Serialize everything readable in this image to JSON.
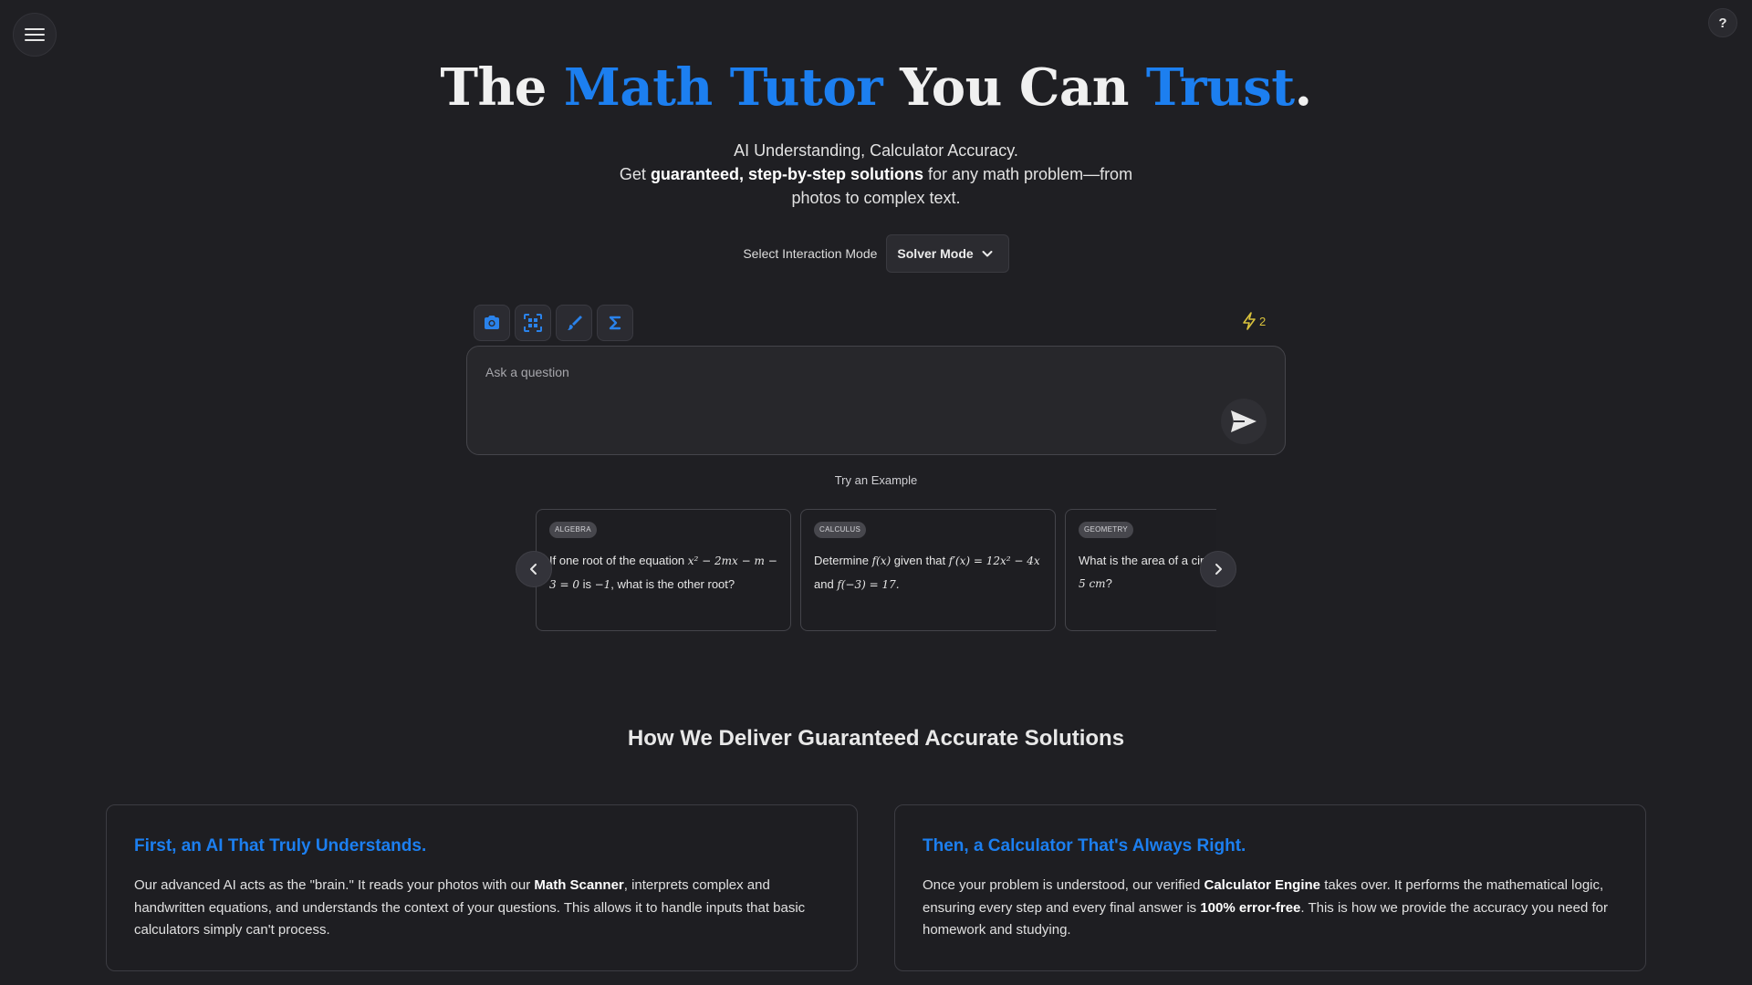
{
  "header": {
    "menu_icon": "hamburger-menu-icon",
    "help_label": "?"
  },
  "hero": {
    "title_parts": [
      "The ",
      "Math Tutor",
      " You Can ",
      "Trust",
      "."
    ],
    "accent_color": "#1c7ff0",
    "subtitle": "AI Understanding, Calculator Accuracy.",
    "desc_prefix": "Get ",
    "desc_bold": "guaranteed, step-by-step solutions",
    "desc_suffix": " for any math problem—from photos to complex text."
  },
  "mode": {
    "label": "Select Interaction Mode",
    "selected": "Solver Mode"
  },
  "tools": [
    {
      "icon": "camera-icon"
    },
    {
      "icon": "scan-icon"
    },
    {
      "icon": "brush-icon"
    },
    {
      "icon": "sigma-icon"
    }
  ],
  "credits": {
    "icon": "lightning-icon",
    "count": "2",
    "color": "#d9c23c"
  },
  "question": {
    "placeholder": "Ask a question"
  },
  "examples": {
    "label": "Try an Example",
    "cards": [
      {
        "tag": "ALGEBRA",
        "t1": "If one root of the equation ",
        "m1": "x² − 2mx − m − 3 = 0",
        "t2": " is ",
        "m2": "−1",
        "t3": ", what is the other root?"
      },
      {
        "tag": "CALCULUS",
        "t1": "Determine ",
        "m1": "f(x)",
        "t2": " given that ",
        "m2": "f′(x) = 12x² − 4x",
        "t3": " and ",
        "m3": "f(−3) = 17."
      },
      {
        "tag": "GEOMETRY",
        "t1": "What is the area of a circle with a radius of ",
        "m1": "5 cm",
        "t2": "?"
      }
    ]
  },
  "how": {
    "title": "How We Deliver Guaranteed Accurate Solutions",
    "features": [
      {
        "title": "First, an AI That Truly Understands.",
        "p1": "Our advanced AI acts as the \"brain.\" It reads your photos with our ",
        "b1": "Math Scanner",
        "p2": ", interprets complex and handwritten equations, and understands the context of your questions. This allows it to handle inputs that basic calculators simply can't process."
      },
      {
        "title": "Then, a Calculator That's Always Right.",
        "p1": "Once your problem is understood, our verified ",
        "b1": "Calculator Engine",
        "p2": " takes over. It performs the mathematical logic, ensuring every step and every final answer is ",
        "b2": "100% error-free",
        "p3": ". This is how we provide the accuracy you need for homework and studying."
      }
    ]
  }
}
